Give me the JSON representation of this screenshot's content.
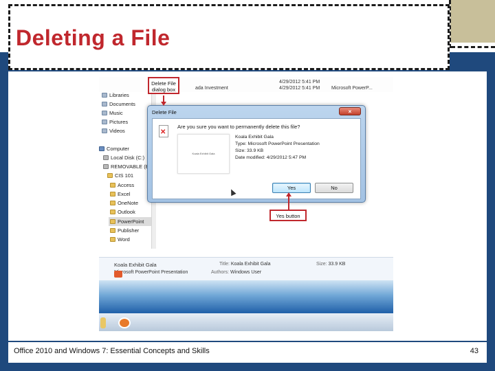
{
  "slide": {
    "title": "Deleting a File",
    "footer": "Office 2010 and Windows 7: Essential Concepts and Skills",
    "page_number": "43"
  },
  "explorer": {
    "top_row": {
      "name": "ada Investment",
      "date1": "4/29/2012 5:41 PM",
      "date2": "4/29/2012 5:41 PM",
      "type": "Microsoft PowerP..."
    },
    "nav_items": [
      {
        "label": "Libraries",
        "icon": "library-icon"
      },
      {
        "label": "Documents",
        "icon": "library-icon"
      },
      {
        "label": "Music",
        "icon": "library-icon"
      },
      {
        "label": "Pictures",
        "icon": "library-icon"
      },
      {
        "label": "Videos",
        "icon": "library-icon"
      },
      {
        "label": "Computer",
        "icon": "computer-icon"
      },
      {
        "label": "Local Disk (C:)",
        "icon": "drive-icon"
      },
      {
        "label": "REMOVABLE (E:)",
        "icon": "drive-icon"
      },
      {
        "label": "CIS 101",
        "icon": "folder-icon"
      },
      {
        "label": "Access",
        "icon": "folder-icon"
      },
      {
        "label": "Excel",
        "icon": "folder-icon"
      },
      {
        "label": "OneNote",
        "icon": "folder-icon"
      },
      {
        "label": "Outlook",
        "icon": "folder-icon"
      },
      {
        "label": "PowerPoint",
        "icon": "folder-icon",
        "selected": true
      },
      {
        "label": "Publisher",
        "icon": "folder-icon"
      },
      {
        "label": "Word",
        "icon": "folder-icon"
      }
    ],
    "details": {
      "name": "Koala Exhibit Gala",
      "type": "Microsoft PowerPoint Presentation",
      "title_label": "Title:",
      "title_value": "Koala Exhibit Gala",
      "authors_label": "Authors:",
      "authors_value": "Windows User",
      "size_label": "Size:",
      "size_value": "33.9 KB"
    }
  },
  "dialog": {
    "title": "Delete File",
    "close_glyph": "×",
    "question": "Are you sure you want to permanently delete this file?",
    "thumb_text": "Koala Exhibit Gala",
    "file_name": "Koala Exhibit Gala",
    "file_type": "Type: Microsoft PowerPoint Presentation",
    "file_size": "Size: 33.9 KB",
    "file_modified": "Date modified: 4/29/2012 5:47 PM",
    "yes_label": "Yes",
    "no_label": "No"
  },
  "callouts": {
    "delete_file": "Delete File dialog box",
    "yes_button": "Yes button"
  },
  "colors": {
    "title": "#c0272d",
    "frame_blue": "#1f497d",
    "accent_tan": "#c8bf9a",
    "callout_border": "#c0272d"
  }
}
